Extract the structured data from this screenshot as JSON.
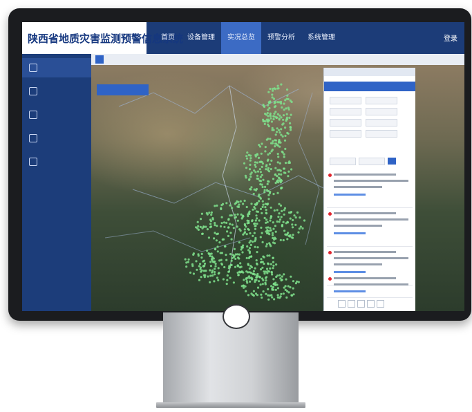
{
  "app": {
    "title": "陕西省地质灾害监测预警信息系统"
  },
  "nav": {
    "items": [
      "首页",
      "设备管理",
      "实况总览",
      "预警分析",
      "系统管理"
    ],
    "active_index": 2
  },
  "header": {
    "login": "登录"
  },
  "colors": {
    "topbar": "#1c3c78",
    "accent": "#2f63c6",
    "sidebar": "#1c3d7a",
    "hazard_points": "#7fe08c",
    "alert_dot": "#e0262f",
    "title_text": "#15377f"
  },
  "icons": [
    "monitor-icon",
    "layer-icon",
    "settings-icon",
    "chart-icon",
    "document-icon",
    "search-icon",
    "alert-icon"
  ],
  "map": {
    "point_color": "#7fe08c"
  }
}
